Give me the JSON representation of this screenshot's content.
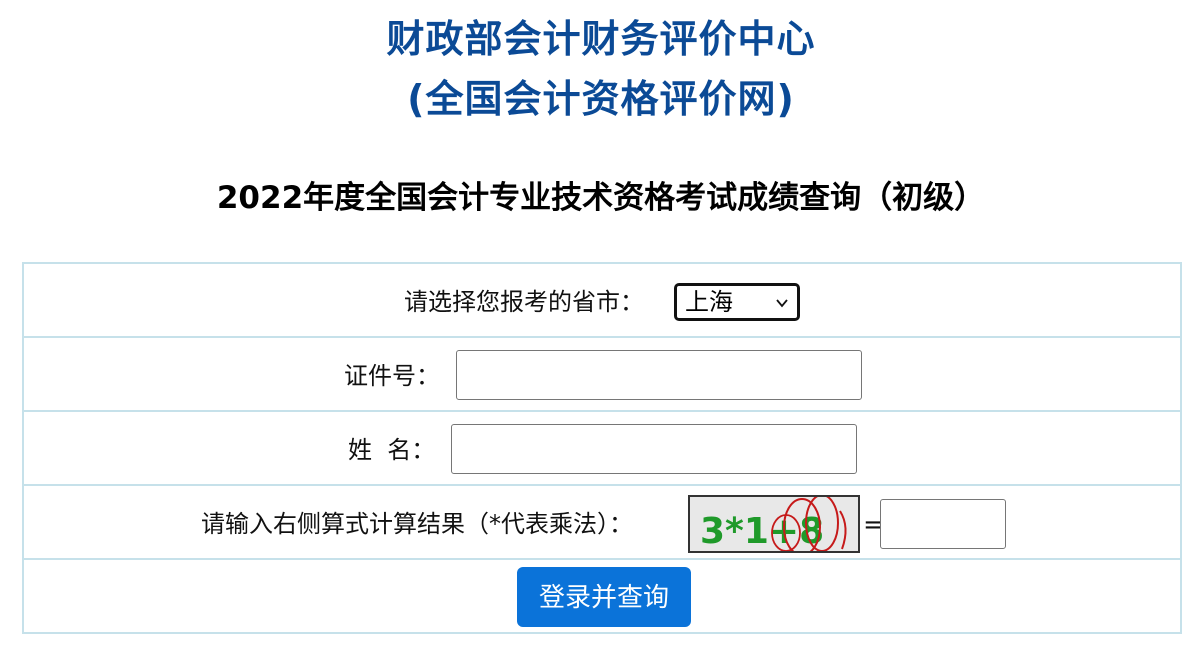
{
  "header": {
    "org_name": "财政部会计财务评价中心",
    "site_name": "(全国会计资格评价网)"
  },
  "page_title": "2022年度全国会计专业技术资格考试成绩查询（初级）",
  "form": {
    "province": {
      "label": "请选择您报考的省市：",
      "selected": "上海"
    },
    "id_number": {
      "label": "证件号：",
      "value": ""
    },
    "name": {
      "label": "姓  名：",
      "value": ""
    },
    "captcha": {
      "label": "请输入右侧算式计算结果（*代表乘法）：",
      "image_text": "3*1+8",
      "equals": "=",
      "answer": ""
    },
    "submit_label": "登录并查询"
  },
  "colors": {
    "header_blue": "#0b4a96",
    "table_border": "#c6e1ea",
    "button_blue": "#0b73d9"
  }
}
